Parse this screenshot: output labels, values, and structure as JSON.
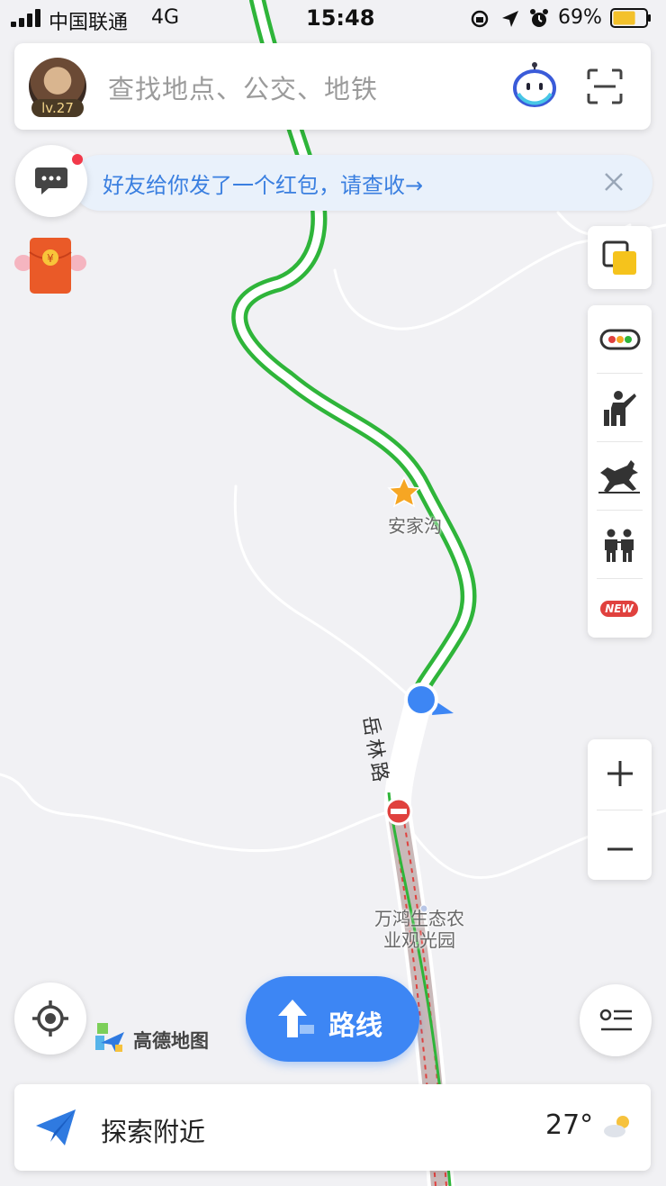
{
  "status_bar": {
    "carrier": "中国联通",
    "network": "4G",
    "time": "15:48",
    "battery": "69%",
    "battery_level": 0.69
  },
  "search": {
    "level": "lv.27",
    "placeholder": "查找地点、公交、地铁"
  },
  "banner": {
    "text": "好友给你发了一个红包，请查收→"
  },
  "map": {
    "poi_label": "安家沟",
    "road_label": "岳林路",
    "park_label_line1": "万鸿生态农",
    "park_label_line2": "业观光园"
  },
  "toolbar": {
    "new_badge": "NEW"
  },
  "bottom": {
    "logo_text": "高德地图",
    "route_label": "路线",
    "explore_label": "探索附近",
    "temperature": "27°"
  },
  "colors": {
    "accent": "#3d86f4",
    "route_green": "#2fb53a",
    "restricted_red": "#e0413e"
  }
}
